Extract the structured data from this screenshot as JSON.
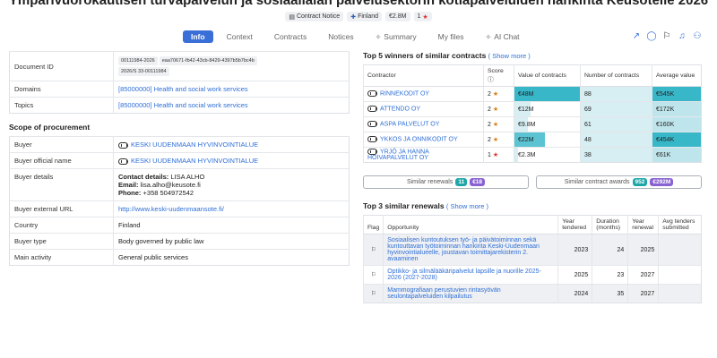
{
  "title": "Ympärivuorokautisen turvapalvelun ja sosiaalialan palvelusektorin kotiapalveluiden hankinta Keusotelle 2026",
  "meta": {
    "notice_icon": "document-icon",
    "notice_label": "Contract Notice",
    "country_label": "Finland",
    "value_label": "€2.8M",
    "rating_label": "1"
  },
  "tabs": [
    {
      "label": "Info",
      "active": true
    },
    {
      "label": "Context"
    },
    {
      "label": "Contracts"
    },
    {
      "label": "Notices"
    },
    {
      "label": "Summary",
      "icon": "sparkle-icon"
    },
    {
      "label": "My files"
    },
    {
      "label": "AI Chat",
      "icon": "sparkle-icon"
    }
  ],
  "action_icons": [
    "share-icon",
    "comment-icon",
    "flag-icon",
    "bell-icon",
    "add-user-icon"
  ],
  "document": {
    "label": "Document ID",
    "ids": [
      "00111984-2026",
      "eaa70671-fb42-43cb-8429-4397b5b7bc4b",
      "2026/S 33-00111984"
    ]
  },
  "domains": {
    "label": "Domains",
    "value": "[85000000] Health and social work services"
  },
  "topics": {
    "label": "Topics",
    "value": "[85000000] Health and social work services"
  },
  "scope_heading": "Scope of procurement",
  "scope": {
    "buyer": {
      "label": "Buyer",
      "value": "KESKI UUDENMAAN HYVINVOINTIALUE"
    },
    "buyer_official_name": {
      "label": "Buyer official name",
      "value": "KESKI UUDENMAAN HYVINVOINTIALUE"
    },
    "buyer_details": {
      "label": "Buyer details",
      "contact_label": "Contact details:",
      "contact_value": "LISA ALHO",
      "email_label": "Email:",
      "email_value": "lisa.alho@keusote.fi",
      "phone_label": "Phone:",
      "phone_value": "+358 504972542"
    },
    "buyer_external_url": {
      "label": "Buyer external URL",
      "value": "http://www.keski-uudenmaansote.fi/"
    },
    "country": {
      "label": "Country",
      "value": "Finland"
    },
    "buyer_type": {
      "label": "Buyer type",
      "value": "Body governed by public law"
    },
    "main_activity": {
      "label": "Main activity",
      "value": "General public services"
    }
  },
  "winners": {
    "heading": "Top 5 winners of similar contracts",
    "show_more": "( Show more )",
    "columns": [
      "Contractor",
      "Score",
      "Value of contracts",
      "Number of contracts",
      "Average value"
    ],
    "rows": [
      {
        "name": "RINNEKODIT OY",
        "score": "2",
        "value": "€48M",
        "value_pct": 100,
        "count": "88",
        "avg": "€545K",
        "avg_pct": 100
      },
      {
        "name": "ATTENDO OY",
        "score": "2",
        "value": "€12M",
        "value_pct": 25,
        "count": "69",
        "avg": "€172K",
        "avg_pct": 32
      },
      {
        "name": "ASPA PALVELUT OY",
        "score": "2",
        "value": "€9.8M",
        "value_pct": 20,
        "count": "61",
        "avg": "€160K",
        "avg_pct": 29
      },
      {
        "name": "YKKOS JA ONNIKODIT OY",
        "score": "2",
        "value": "€22M",
        "value_pct": 46,
        "count": "48",
        "avg": "€454K",
        "avg_pct": 83
      },
      {
        "name": "YRJÖ JA HANNA HOIVAPALVELUT OY",
        "score": "1",
        "value": "€2.3M",
        "value_pct": 5,
        "count": "38",
        "avg": "€61K",
        "avg_pct": 11
      }
    ]
  },
  "similar_renewals_btn": {
    "label": "Similar renewals",
    "count": "11",
    "value": "€18"
  },
  "similar_awards_btn": {
    "label": "Similar contract awards",
    "count": "952",
    "value": "€292M"
  },
  "renewals": {
    "heading": "Top 3 similar renewals",
    "show_more": "( Show more )",
    "columns": [
      "Flag",
      "Opportunity",
      "Year tendered",
      "Duration (months)",
      "Year renewal",
      "Avg tenders submitted"
    ],
    "rows": [
      {
        "title": "Sosiaalisen kuntoutuksen työ- ja päivätoiminnan sekä kuntouttavan työtoiminnan hankinta Keski-Uudenmaan hyvinvointialueelle, joustavan toimittajarekisterin 2. avaaminen",
        "year": "2023",
        "duration": "24",
        "renewal": "2025",
        "avg": ""
      },
      {
        "title": "Optikko- ja silmälääkäripalvelut lapsille ja nuorille 2025-2026 (2027-2028)",
        "year": "2025",
        "duration": "23",
        "renewal": "2027",
        "avg": ""
      },
      {
        "title": "Mammografiaan perustuvien rintasyövän seulontapalveluiden kilpailutus",
        "year": "2024",
        "duration": "35",
        "renewal": "2027",
        "avg": ""
      }
    ]
  }
}
